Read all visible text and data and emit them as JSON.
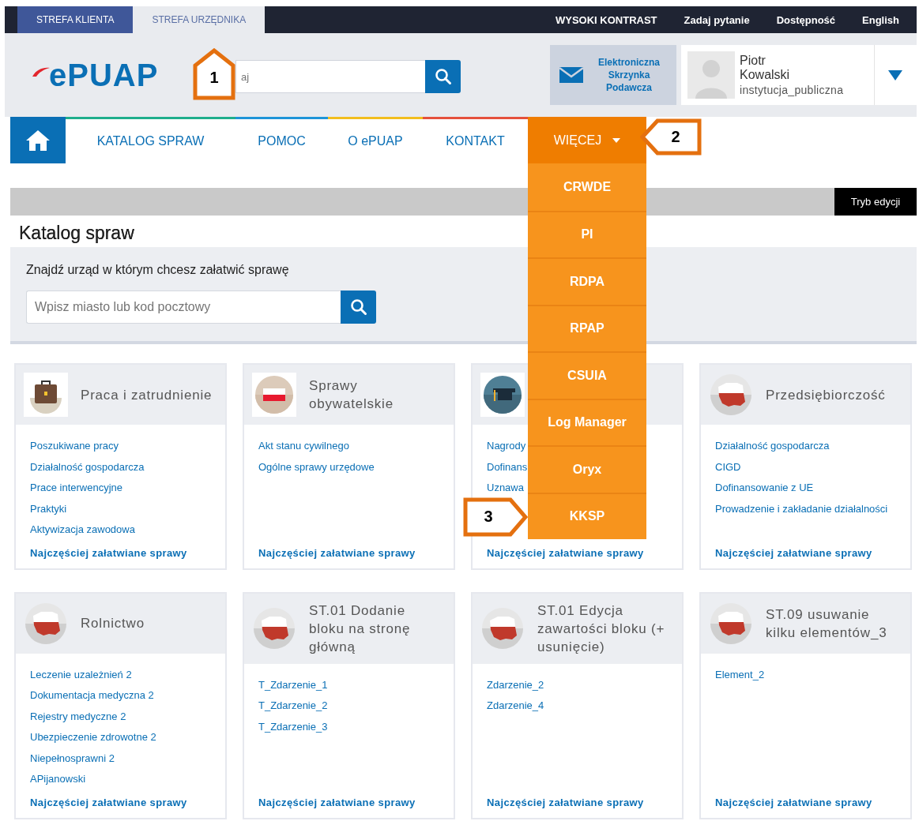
{
  "top_bar": {
    "zones": [
      {
        "label": "STREFA KLIENTA",
        "selected": false
      },
      {
        "label": "STREFA URZĘDNIKA",
        "selected": true
      }
    ],
    "links": [
      "WYSOKI KONTRAST",
      "Zadaj pytanie",
      "Dostępność",
      "English"
    ]
  },
  "header": {
    "logo": "ePUAP",
    "search": {
      "placeholder": "aj",
      "callout": "1"
    },
    "mailbox": "Elektroniczna Skrzynka Podawcza",
    "user": {
      "name": "Piotr Kowalski",
      "role": "instytucja_publiczna"
    }
  },
  "nav": {
    "items": [
      {
        "label": "KATALOG SPRAW",
        "color": "#1fae8c"
      },
      {
        "label": "POMOC",
        "color": "#1e94d8"
      },
      {
        "label": "O ePUAP",
        "color": "#f2bd1d"
      },
      {
        "label": "KONTAKT",
        "color": "#e5503c"
      }
    ],
    "more": {
      "label": "WIĘCEJ",
      "expanded": true,
      "callout": "2",
      "items": [
        {
          "label": "CRWDE"
        },
        {
          "label": "PI"
        },
        {
          "label": "RDPA"
        },
        {
          "label": "RPAP"
        },
        {
          "label": "CSUIA"
        },
        {
          "label": "Log Manager"
        },
        {
          "label": "Oryx"
        },
        {
          "label": "KKSP",
          "callout": "3"
        }
      ]
    }
  },
  "edit_mode_button": "Tryb edycji",
  "page_title": "Katalog spraw",
  "office_search": {
    "label": "Znajdź urząd w którym chcesz załatwić sprawę",
    "placeholder": "Wpisz miasto lub kod pocztowy"
  },
  "cards": [
    {
      "kind": "briefcase",
      "title": "Praca i zatrudnienie",
      "links": [
        "Poszukiwane pracy",
        "Działalność gospodarcza",
        "Prace interwencyjne",
        "Praktyki",
        "Aktywizacja zawodowa"
      ],
      "footer_link": "Najczęściej załatwiane sprawy"
    },
    {
      "kind": "flag",
      "title": "Sprawy obywatelskie",
      "links": [
        "Akt stanu cywilnego",
        "Ogólne sprawy urzędowe"
      ],
      "footer_link": "Najczęściej załatwiane sprawy"
    },
    {
      "kind": "mortarboard",
      "links": [
        "Nagrody",
        "Dofinans",
        "Uznawa"
      ],
      "footer_link": "Najczęściej załatwiane sprawy"
    },
    {
      "kind": "map",
      "title": "Przedsiębiorczość",
      "links": [
        "Działalność gospodarcza",
        "CIGD",
        "Dofinansowanie z UE",
        "Prowadzenie i zakładanie działalności"
      ],
      "footer_link": "Najczęściej załatwiane sprawy"
    },
    {
      "kind": "map",
      "title": "Rolnictwo",
      "links": [
        "Leczenie uzależnień 2",
        "Dokumentacja medyczna 2",
        "Rejestry medyczne 2",
        "Ubezpieczenie zdrowotne 2",
        "Niepełnosprawni 2",
        "APijanowski"
      ],
      "footer_link": "Najczęściej załatwiane sprawy"
    },
    {
      "kind": "map",
      "title": "ST.01 Dodanie bloku na stronę główną",
      "links": [
        "T_Zdarzenie_1",
        "T_Zdarzenie_2",
        "T_Zdarzenie_3"
      ],
      "footer_link": "Najczęściej załatwiane sprawy"
    },
    {
      "kind": "map",
      "title": "ST.01 Edycja zawartości bloku (+ usunięcie)",
      "links": [
        "Zdarzenie_2",
        "Zdarzenie_4"
      ],
      "footer_link": "Najczęściej załatwiane sprawy"
    },
    {
      "kind": "map",
      "title": "ST.09 usuwanie kilku elementów_3",
      "links": [
        "Element_2"
      ],
      "footer_link": "Najczęściej załatwiane sprawy"
    }
  ]
}
